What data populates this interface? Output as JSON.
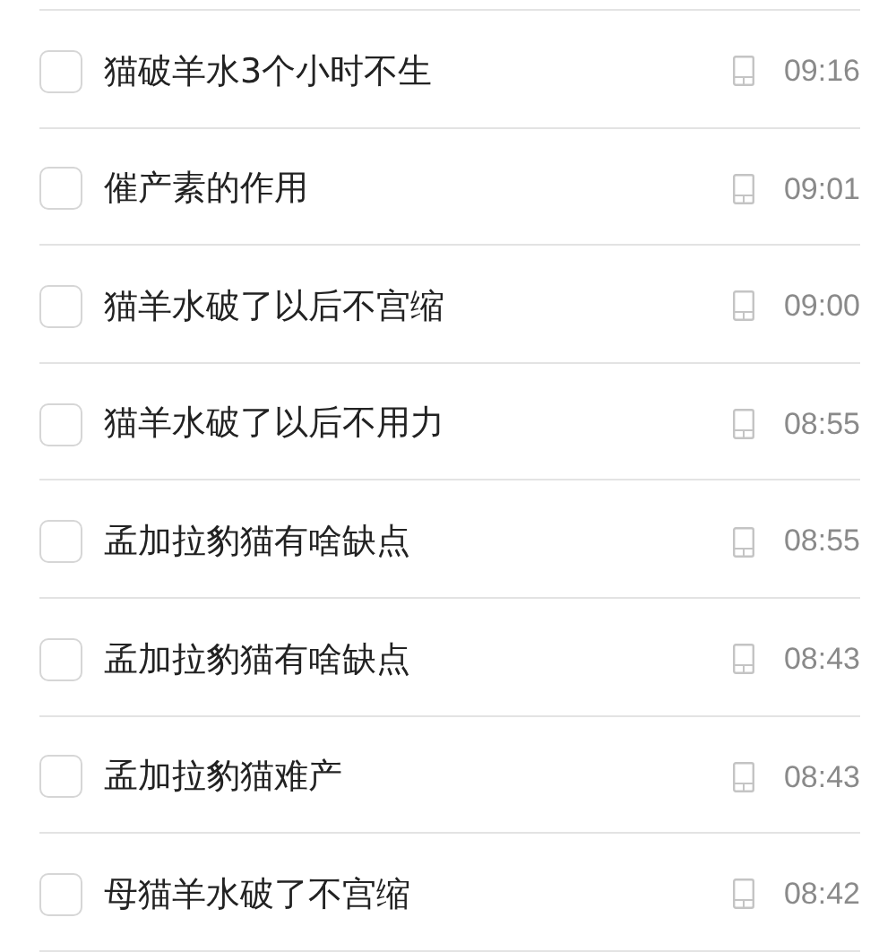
{
  "items": [
    {
      "title": "猫破羊水3个小时不生",
      "checked": false,
      "time": "09:16"
    },
    {
      "title": "催产素的作用",
      "checked": false,
      "time": "09:01"
    },
    {
      "title": "猫羊水破了以后不宫缩",
      "checked": false,
      "time": "09:00"
    },
    {
      "title": "猫羊水破了以后不用力",
      "checked": false,
      "time": "08:55"
    },
    {
      "title": "孟加拉豹猫有啥缺点",
      "checked": false,
      "time": "08:55"
    },
    {
      "title": "孟加拉豹猫有啥缺点",
      "checked": false,
      "time": "08:43"
    },
    {
      "title": "孟加拉豹猫难产",
      "checked": false,
      "time": "08:43"
    },
    {
      "title": "母猫羊水破了不宫缩",
      "checked": false,
      "time": "08:42"
    }
  ]
}
